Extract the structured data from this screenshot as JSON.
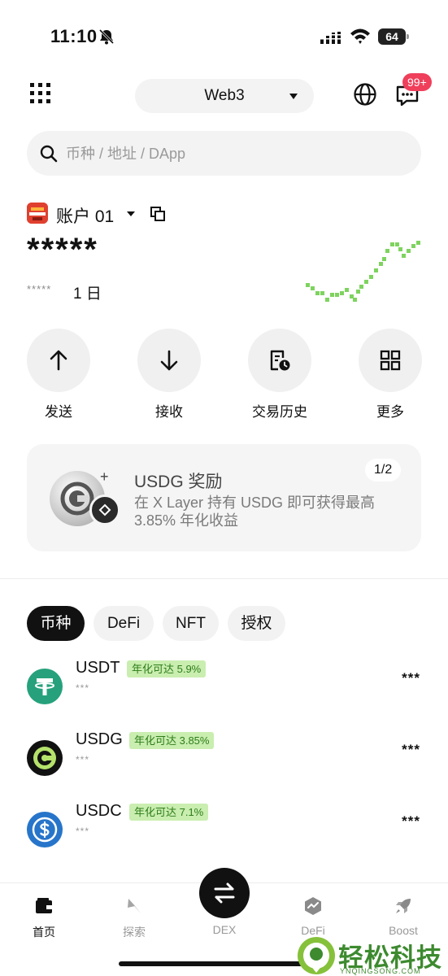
{
  "status_bar": {
    "time": "11:10",
    "battery": "64"
  },
  "header": {
    "network": "Web3",
    "badge": "99+"
  },
  "search": {
    "placeholder": "币种 / 地址 / DApp"
  },
  "account": {
    "name": "账户 01",
    "balance": "*****",
    "change": "*****",
    "period": "1 日"
  },
  "actions": [
    {
      "label": "发送",
      "icon": "arrow-up-icon"
    },
    {
      "label": "接收",
      "icon": "arrow-down-icon"
    },
    {
      "label": "交易历史",
      "icon": "history-icon"
    },
    {
      "label": "更多",
      "icon": "grid-icon"
    }
  ],
  "promo": {
    "title": "USDG 奖励",
    "description": "在 X Layer 持有 USDG 即可获得最高 3.85% 年化收益",
    "pager": "1/2",
    "plus": "+"
  },
  "tabs": [
    "币种",
    "DeFi",
    "NFT",
    "授权"
  ],
  "tokens": [
    {
      "symbol": "USDT",
      "apy": "年化可达 5.9%",
      "sub": "***",
      "value": "***",
      "color": "#26a17b"
    },
    {
      "symbol": "USDG",
      "apy": "年化可达 3.85%",
      "sub": "***",
      "value": "***",
      "color": "#111111"
    },
    {
      "symbol": "USDC",
      "apy": "年化可达 7.1%",
      "sub": "***",
      "value": "***",
      "color": "#2775ca"
    }
  ],
  "bottom_nav": [
    {
      "label": "首页",
      "icon": "wallet-icon"
    },
    {
      "label": "探索",
      "icon": "compass-icon"
    },
    {
      "label": "DEX",
      "icon": "swap-icon"
    },
    {
      "label": "DeFi",
      "icon": "defi-icon"
    },
    {
      "label": "Boost",
      "icon": "rocket-icon"
    }
  ],
  "watermark": {
    "name": "轻松科技",
    "domain": "YNQINGSONG.COM"
  },
  "colors": {
    "accent_green": "#86c13b",
    "badge_red": "#ef3f5b",
    "apy_bg": "#c9eeb0"
  }
}
